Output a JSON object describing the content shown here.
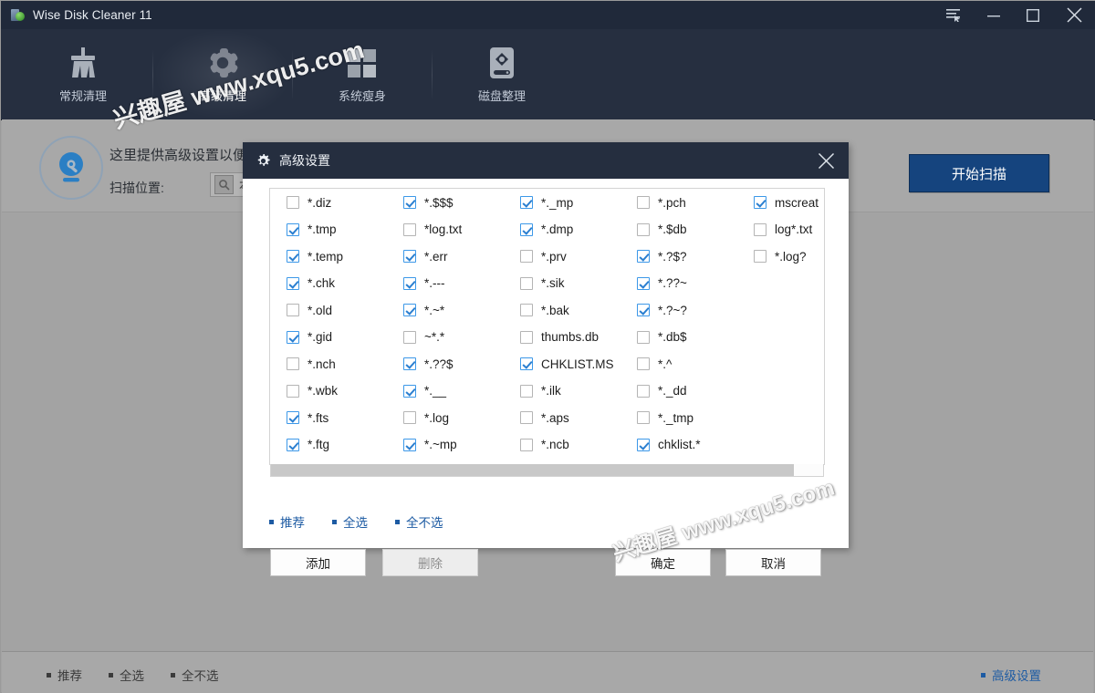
{
  "window": {
    "title": "Wise Disk Cleaner 11",
    "icon": "disk-cleaner-logo-icon",
    "controls": {
      "menu": "menu-icon",
      "minimize": "minimize-icon",
      "maximize": "maximize-icon",
      "close": "close-icon"
    }
  },
  "toolbar": {
    "items": [
      {
        "label": "常规清理",
        "icon": "broom-icon",
        "active": false
      },
      {
        "label": "高级清理",
        "icon": "gear-icon",
        "active": true
      },
      {
        "label": "系统瘦身",
        "icon": "windows-logo-icon",
        "active": false
      },
      {
        "label": "磁盘整理",
        "icon": "hard-disk-icon",
        "active": false
      }
    ]
  },
  "main": {
    "description": "这里提供高级设置以便",
    "scan_location_label": "扫描位置:",
    "scan_location_value": "本",
    "scan_location_icon": "disk-search-icon",
    "disk_icon": "disk-scan-icon",
    "scan_button": "开始扫描",
    "scan_button_color": "#15447e"
  },
  "bottom_bar": {
    "links": [
      {
        "label": "推荐",
        "state": "disabled"
      },
      {
        "label": "全选",
        "state": "disabled"
      },
      {
        "label": "全不选",
        "state": "disabled"
      }
    ],
    "advanced_settings": {
      "label": "高级设置",
      "state": "active"
    }
  },
  "dialog": {
    "title": "高级设置",
    "title_icon": "gear-icon",
    "close_icon": "close-icon",
    "scrollbar": "horizontal-scrollbar",
    "columns": [
      {
        "items": [
          {
            "label": "*.diz",
            "checked": false
          },
          {
            "label": "*.tmp",
            "checked": true
          },
          {
            "label": "*.temp",
            "checked": true
          },
          {
            "label": "*.chk",
            "checked": true
          },
          {
            "label": "*.old",
            "checked": false
          },
          {
            "label": "*.gid",
            "checked": true
          },
          {
            "label": "*.nch",
            "checked": false
          },
          {
            "label": "*.wbk",
            "checked": false
          },
          {
            "label": "*.fts",
            "checked": true
          },
          {
            "label": "*.ftg",
            "checked": true
          }
        ]
      },
      {
        "items": [
          {
            "label": "*.$$$",
            "checked": true
          },
          {
            "label": "*log.txt",
            "checked": false
          },
          {
            "label": "*.err",
            "checked": true
          },
          {
            "label": "*.---",
            "checked": true
          },
          {
            "label": "*.~*",
            "checked": true
          },
          {
            "label": "~*.*",
            "checked": false
          },
          {
            "label": "*.??$",
            "checked": true
          },
          {
            "label": "*.__",
            "checked": true
          },
          {
            "label": "*.log",
            "checked": false
          },
          {
            "label": "*.~mp",
            "checked": true
          }
        ]
      },
      {
        "items": [
          {
            "label": "*._mp",
            "checked": true
          },
          {
            "label": "*.dmp",
            "checked": true
          },
          {
            "label": "*.prv",
            "checked": false
          },
          {
            "label": "*.sik",
            "checked": false
          },
          {
            "label": "*.bak",
            "checked": false
          },
          {
            "label": "thumbs.db",
            "checked": false
          },
          {
            "label": "CHKLIST.MS",
            "checked": true
          },
          {
            "label": "*.ilk",
            "checked": false
          },
          {
            "label": "*.aps",
            "checked": false
          },
          {
            "label": "*.ncb",
            "checked": false
          }
        ]
      },
      {
        "items": [
          {
            "label": "*.pch",
            "checked": false
          },
          {
            "label": "*.$db",
            "checked": false
          },
          {
            "label": "*.?$?",
            "checked": true
          },
          {
            "label": "*.??~",
            "checked": true
          },
          {
            "label": "*.?~?",
            "checked": true
          },
          {
            "label": "*.db$",
            "checked": false
          },
          {
            "label": "*.^",
            "checked": false
          },
          {
            "label": "*._dd",
            "checked": false
          },
          {
            "label": "*._tmp",
            "checked": false
          },
          {
            "label": "chklist.*",
            "checked": true
          }
        ]
      },
      {
        "items": [
          {
            "label": "mscreat",
            "checked": true
          },
          {
            "label": "log*.txt",
            "checked": false
          },
          {
            "label": "*.log?",
            "checked": false
          }
        ]
      }
    ],
    "links": [
      {
        "label": "推荐"
      },
      {
        "label": "全选"
      },
      {
        "label": "全不选"
      }
    ],
    "buttons": {
      "add": "添加",
      "remove": "删除",
      "ok": "确定",
      "cancel": "取消"
    }
  },
  "watermarks": [
    {
      "text": "兴趣屋 www.xqu5.com"
    },
    {
      "text": "兴趣屋 www.xqu5.com"
    }
  ]
}
